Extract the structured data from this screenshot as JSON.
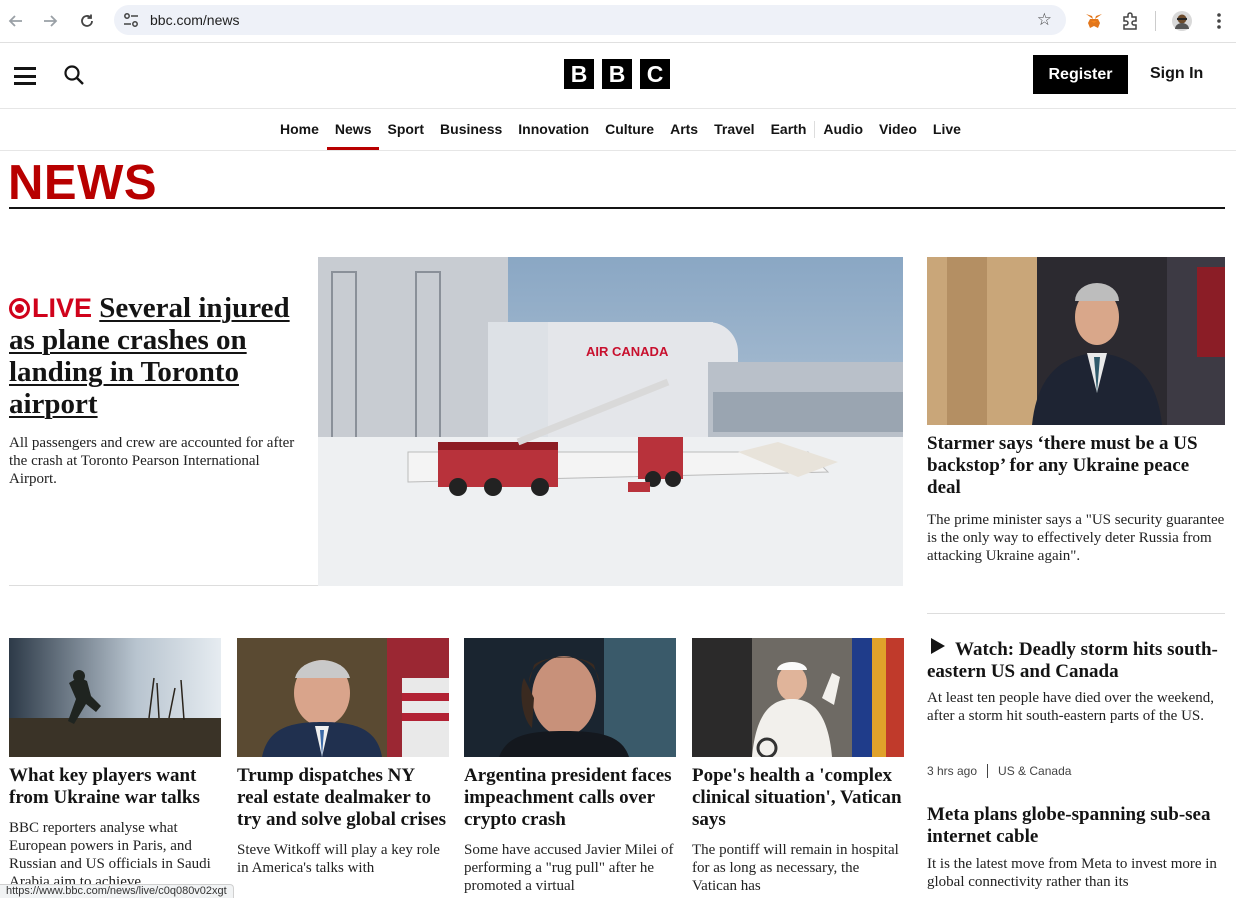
{
  "browser": {
    "url": "bbc.com/news",
    "status_url": "https://www.bbc.com/news/live/c0q080v02xgt"
  },
  "masthead": {
    "logo_letters": [
      "B",
      "B",
      "C"
    ],
    "register_label": "Register",
    "signin_label": "Sign In"
  },
  "nav": {
    "items": [
      "Home",
      "News",
      "Sport",
      "Business",
      "Innovation",
      "Culture",
      "Arts",
      "Travel",
      "Earth",
      "Audio",
      "Video",
      "Live"
    ],
    "active": "News"
  },
  "section_title": "NEWS",
  "lead": {
    "live_label": "LIVE",
    "headline": "Several injured as plane crashes on landing in Toronto airport",
    "summary": "All passengers and crew are accounted for after the crash at Toronto Pearson International Airport.",
    "image_sign": "AIR CANADA"
  },
  "right": {
    "top": {
      "headline": "Starmer says ‘there must be a US backstop’ for any Ukraine peace deal",
      "summary": "The prime minister says a \"US security guarantee is the only way to effectively deter Russia from attacking Ukraine again\"."
    },
    "watch": {
      "headline": "Watch: Deadly storm hits south-eastern US and Canada",
      "summary": "At least ten people have died over the weekend, after a storm hit south-eastern parts of the US.",
      "time": "3 hrs ago",
      "tag": "US & Canada"
    },
    "meta": {
      "headline": "Meta plans globe-spanning sub-sea internet cable",
      "summary": "It is the latest move from Meta to invest more in global connectivity rather than its"
    }
  },
  "cards": [
    {
      "headline": "What key players want from Ukraine war talks",
      "summary": "BBC reporters analyse what European powers in Paris, and Russian and US officials in Saudi Arabia aim to achieve."
    },
    {
      "headline": "Trump dispatches NY real estate dealmaker to try and solve global crises",
      "summary": "Steve Witkoff will play a key role in America's talks with"
    },
    {
      "headline": "Argentina president faces impeachment calls over crypto crash",
      "summary": "Some have accused Javier Milei of performing a \"rug pull\" after he promoted a virtual"
    },
    {
      "headline": "Pope's health a 'complex clinical situation', Vatican says",
      "summary": "The pontiff will remain in hospital for as long as necessary, the Vatican has"
    }
  ],
  "colors": {
    "brand_red": "#b80000",
    "live_red": "#d0021b",
    "text": "#141414"
  }
}
